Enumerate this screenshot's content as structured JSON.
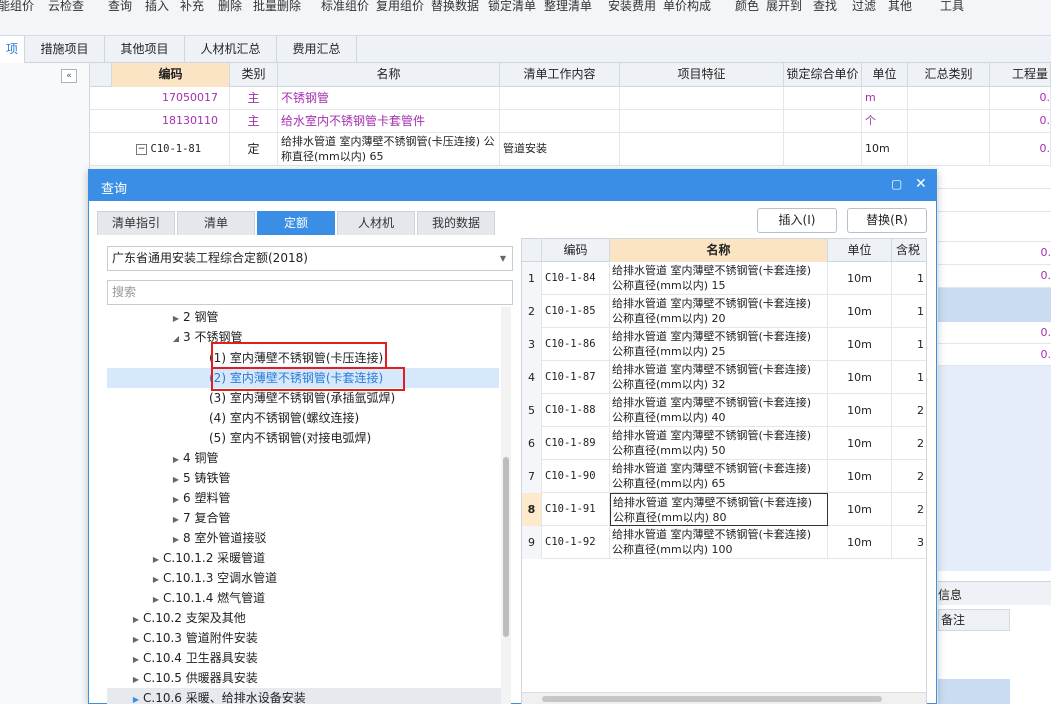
{
  "toolbar": {
    "items": [
      "能组价",
      "云检查",
      "查询",
      "插入",
      "补充",
      "删除",
      "批量删除",
      "标准组价",
      "复用组价",
      "替换数据",
      "锁定清单",
      "整理清单",
      "安装费用",
      "单价构成",
      "颜色",
      "展开到",
      "查找",
      "过滤",
      "其他",
      "工具"
    ]
  },
  "tabs": [
    "项",
    "措施项目",
    "其他项目",
    "人材机汇总",
    "费用汇总"
  ],
  "grid": {
    "headers": [
      "编码",
      "类别",
      "名称",
      "清单工作内容",
      "项目特征",
      "锁定综合单价",
      "单位",
      "汇总类别",
      "工程量"
    ],
    "rows": [
      {
        "code": "17050017",
        "type": "主",
        "name": "不锈钢管",
        "unit": "m",
        "qty": "0."
      },
      {
        "code": "18130110",
        "type": "主",
        "name": "给水室内不锈钢管卡套管件",
        "unit": "个",
        "qty": "0."
      },
      {
        "code": "C10-1-81",
        "type": "定",
        "name": "给排水管道 室内薄壁不锈钢管(卡压连接) 公称直径(mm以内) 65",
        "work": "管道安装",
        "unit": "10m",
        "qty": "0."
      }
    ],
    "right_values": [
      "0.",
      "0.",
      "0.",
      "0."
    ],
    "bottom_tab": "信息",
    "bottom_col": "备注"
  },
  "dialog": {
    "title": "查询",
    "tabs": [
      "清单指引",
      "清单",
      "定额",
      "人材机",
      "我的数据"
    ],
    "insert_label": "插入(I)",
    "replace_label": "替换(R)",
    "library": "广东省通用安装工程综合定额(2018)",
    "search_placeholder": "搜索",
    "tree": [
      {
        "label": "2 钢管",
        "level": 3,
        "arrow": "▶"
      },
      {
        "label": "3 不锈钢管",
        "level": 3,
        "arrow": "◢"
      },
      {
        "label": "(1) 室内薄壁不锈钢管(卡压连接)",
        "level": 4,
        "arrow": ""
      },
      {
        "label": "(2) 室内薄壁不锈钢管(卡套连接)",
        "level": 4,
        "arrow": ""
      },
      {
        "label": "(3) 室内薄壁不锈钢管(承插氩弧焊)",
        "level": 4,
        "arrow": ""
      },
      {
        "label": "(4) 室内不锈钢管(螺纹连接)",
        "level": 4,
        "arrow": ""
      },
      {
        "label": "(5) 室内不锈钢管(对接电弧焊)",
        "level": 4,
        "arrow": ""
      },
      {
        "label": "4 铜管",
        "level": 3,
        "arrow": "▶"
      },
      {
        "label": "5 铸铁管",
        "level": 3,
        "arrow": "▶"
      },
      {
        "label": "6 塑料管",
        "level": 3,
        "arrow": "▶"
      },
      {
        "label": "7 复合管",
        "level": 3,
        "arrow": "▶"
      },
      {
        "label": "8 室外管道接驳",
        "level": 3,
        "arrow": "▶"
      },
      {
        "label": "C.10.1.2 采暖管道",
        "level": 2,
        "arrow": "▶"
      },
      {
        "label": "C.10.1.3 空调水管道",
        "level": 2,
        "arrow": "▶"
      },
      {
        "label": "C.10.1.4 燃气管道",
        "level": 2,
        "arrow": "▶"
      },
      {
        "label": "C.10.2 支架及其他",
        "level": 1,
        "arrow": "▶"
      },
      {
        "label": "C.10.3 管道附件安装",
        "level": 1,
        "arrow": "▶"
      },
      {
        "label": "C.10.4 卫生器具安装",
        "level": 1,
        "arrow": "▶"
      },
      {
        "label": "C.10.5 供暖器具安装",
        "level": 1,
        "arrow": "▶"
      },
      {
        "label": "C.10.6 采暖、给排水设备安装",
        "level": 1,
        "arrow": "▶"
      }
    ],
    "result_headers": [
      "编码",
      "名称",
      "单位",
      "含税"
    ],
    "results": [
      {
        "n": "1",
        "code": "C10-1-84",
        "name": "给排水管道 室内薄壁不锈钢管(卡套连接) 公称直径(mm以内) 15",
        "unit": "10m",
        "tax": "1"
      },
      {
        "n": "2",
        "code": "C10-1-85",
        "name": "给排水管道 室内薄壁不锈钢管(卡套连接) 公称直径(mm以内) 20",
        "unit": "10m",
        "tax": "1"
      },
      {
        "n": "3",
        "code": "C10-1-86",
        "name": "给排水管道 室内薄壁不锈钢管(卡套连接) 公称直径(mm以内) 25",
        "unit": "10m",
        "tax": "1"
      },
      {
        "n": "4",
        "code": "C10-1-87",
        "name": "给排水管道 室内薄壁不锈钢管(卡套连接) 公称直径(mm以内) 32",
        "unit": "10m",
        "tax": "1"
      },
      {
        "n": "5",
        "code": "C10-1-88",
        "name": "给排水管道 室内薄壁不锈钢管(卡套连接) 公称直径(mm以内) 40",
        "unit": "10m",
        "tax": "2"
      },
      {
        "n": "6",
        "code": "C10-1-89",
        "name": "给排水管道 室内薄壁不锈钢管(卡套连接) 公称直径(mm以内) 50",
        "unit": "10m",
        "tax": "2"
      },
      {
        "n": "7",
        "code": "C10-1-90",
        "name": "给排水管道 室内薄壁不锈钢管(卡套连接) 公称直径(mm以内) 65",
        "unit": "10m",
        "tax": "2"
      },
      {
        "n": "8",
        "code": "C10-1-91",
        "name": "给排水管道 室内薄壁不锈钢管(卡套连接) 公称直径(mm以内) 80",
        "unit": "10m",
        "tax": "2"
      },
      {
        "n": "9",
        "code": "C10-1-92",
        "name": "给排水管道 室内薄壁不锈钢管(卡套连接) 公称直径(mm以内) 100",
        "unit": "10m",
        "tax": "3"
      }
    ]
  }
}
